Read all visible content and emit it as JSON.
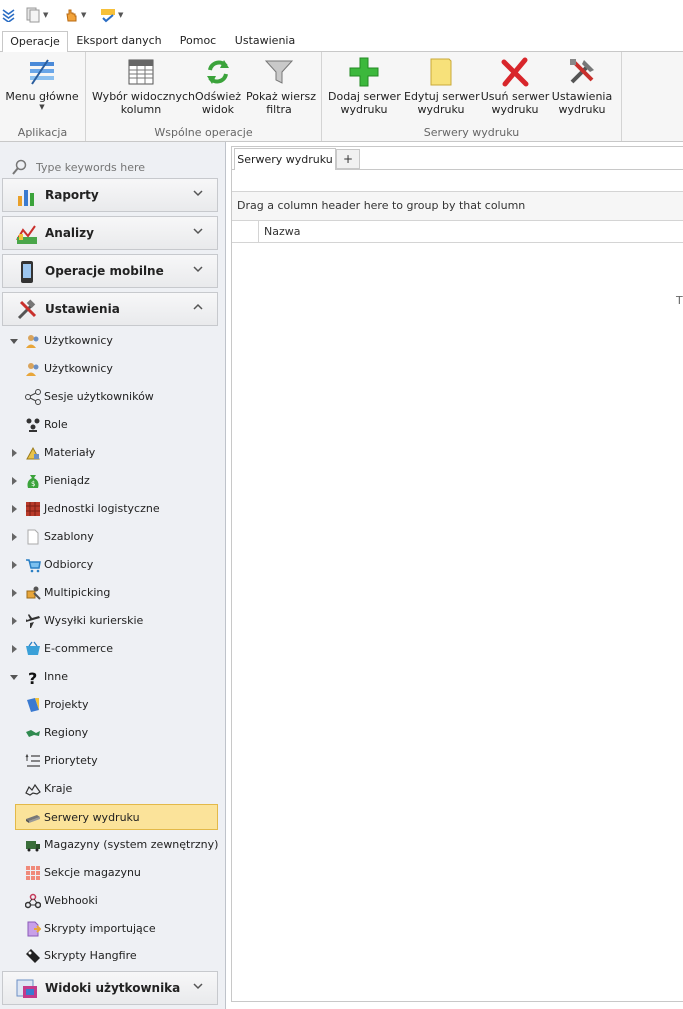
{
  "ribbon_tabs": [
    "Operacje",
    "Eksport danych",
    "Pomoc",
    "Ustawienia"
  ],
  "ribbon": {
    "groups": {
      "app": "Aplikacja",
      "common": "Wspólne operacje",
      "servers": "Serwery wydruku"
    },
    "buttons": {
      "menu_line1": "Menu główne",
      "columns_line1": "Wybór widocznych",
      "columns_line2": "kolumn",
      "refresh_line1": "Odśwież",
      "refresh_line2": "widok",
      "filter_line1": "Pokaż wiersz",
      "filter_line2": "filtra",
      "add_line1": "Dodaj serwer",
      "add_line2": "wydruku",
      "edit_line1": "Edytuj serwer",
      "edit_line2": "wydruku",
      "delete_line1": "Usuń serwer",
      "delete_line2": "wydruku",
      "settings_line1": "Ustawienia",
      "settings_line2": "wydruku"
    }
  },
  "sidebar": {
    "search_placeholder": "Type keywords here",
    "headers": {
      "raporty": "Raporty",
      "analizy": "Analizy",
      "mobile": "Operacje mobilne",
      "ustawienia": "Ustawienia",
      "widoki": "Widoki użytkownika"
    },
    "items": [
      "Użytkownicy",
      "Użytkownicy",
      "Sesje użytkowników",
      "Role",
      "Materiały",
      "Pieniądz",
      "Jednostki logistyczne",
      "Szablony",
      "Odbiorcy",
      "Multipicking",
      "Wysyłki kurierskie",
      "E-commerce",
      "Inne",
      "Projekty",
      "Regiony",
      "Priorytety",
      "Kraje",
      "Serwery wydruku",
      "Magazyny (system zewnętrzny)",
      "Sekcje magazynu",
      "Webhooki",
      "Skrypty importujące",
      "Skrypty Hangfire"
    ]
  },
  "main": {
    "tab_label": "Serwery wydruku",
    "add_tab": "+",
    "group_hint": "Drag a column header here to group by that column",
    "column_name": "Nazwa",
    "truncated_text": "T"
  }
}
